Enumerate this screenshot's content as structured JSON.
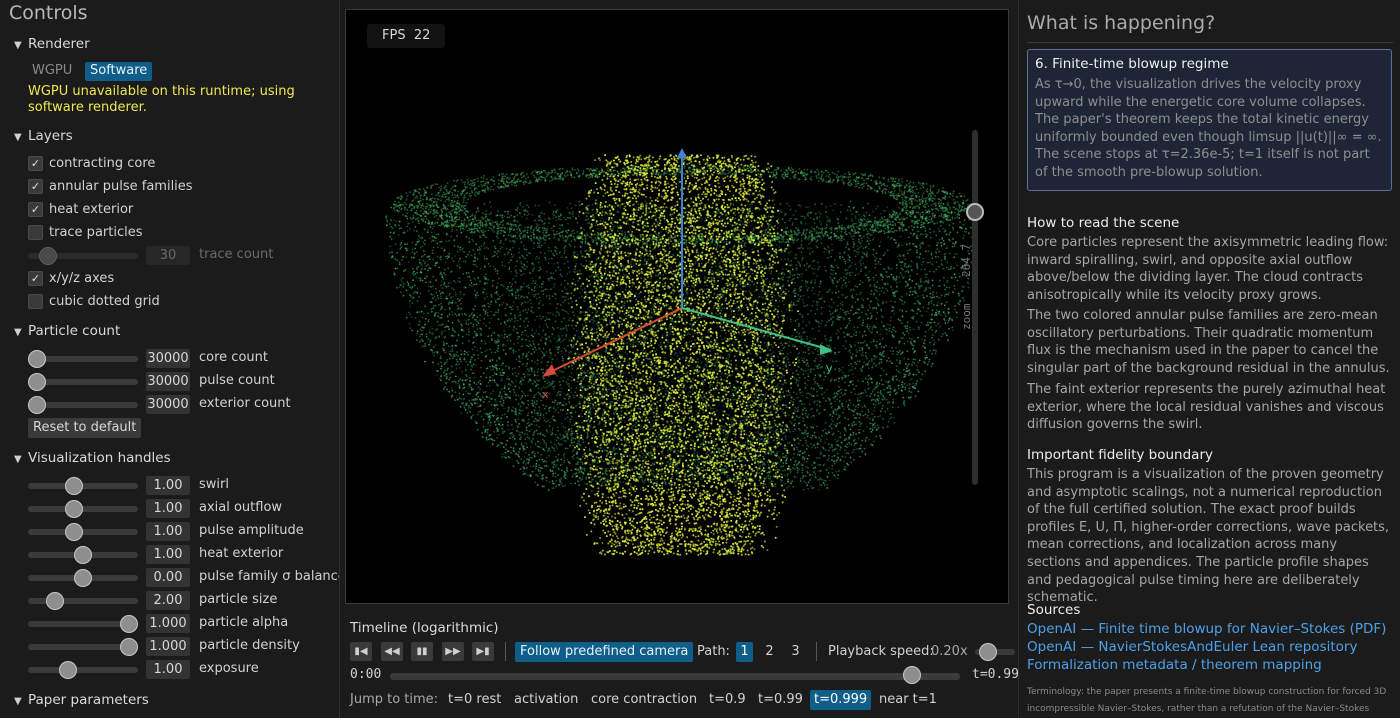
{
  "controls": {
    "title": "Controls",
    "renderer": {
      "heading": "Renderer",
      "modes": [
        "WGPU",
        "Software"
      ],
      "selected": "Software",
      "warning": "WGPU unavailable on this runtime; using software renderer."
    },
    "layers": {
      "heading": "Layers",
      "items": [
        {
          "label": "contracting core",
          "checked": true
        },
        {
          "label": "annular pulse families",
          "checked": true
        },
        {
          "label": "heat exterior",
          "checked": true
        },
        {
          "label": "trace particles",
          "checked": false
        },
        {
          "label": "x/y/z axes",
          "checked": true
        },
        {
          "label": "cubic dotted grid",
          "checked": false
        }
      ],
      "trace_count": {
        "label": "trace count",
        "value": "30",
        "level": 0.2,
        "disabled": true
      }
    },
    "particle_count": {
      "heading": "Particle count",
      "sliders": [
        {
          "label": "core count",
          "value": "30000",
          "level": 0.0
        },
        {
          "label": "pulse count",
          "value": "30000",
          "level": 0.0
        },
        {
          "label": "exterior count",
          "value": "30000",
          "level": 0.0
        }
      ],
      "reset_label": "Reset to default"
    },
    "visualization_handles": {
      "heading": "Visualization handles",
      "sliders": [
        {
          "label": "swirl",
          "value": "1.00",
          "level": 0.4
        },
        {
          "label": "axial outflow",
          "value": "1.00",
          "level": 0.4
        },
        {
          "label": "pulse amplitude",
          "value": "1.00",
          "level": 0.4
        },
        {
          "label": "heat exterior",
          "value": "1.00",
          "level": 0.5
        },
        {
          "label": "pulse family σ balance",
          "value": "0.00",
          "level": 0.5
        },
        {
          "label": "particle size",
          "value": "2.00",
          "level": 0.2
        },
        {
          "label": "particle alpha",
          "value": "1.000",
          "level": 1.0
        },
        {
          "label": "particle density",
          "value": "1.000",
          "level": 1.0
        },
        {
          "label": "exposure",
          "value": "1.00",
          "level": 0.34
        }
      ]
    },
    "paper_parameters": {
      "heading": "Paper parameters"
    }
  },
  "viewport": {
    "fps_label": "FPS",
    "fps_value": "22",
    "zoom_label": "zoom",
    "zoom_value": "264.7",
    "zoom_level": 0.78,
    "axes": {
      "x": "x",
      "y": "y",
      "x_color": "#d84a3a",
      "y_color": "#3ec088",
      "z_color": "#3a84d8"
    },
    "colors": {
      "core": "#e6f03a",
      "pulse": "#4ec86a",
      "exterior": "#2e9a68"
    }
  },
  "timeline": {
    "title": "Timeline (logarithmic)",
    "buttons": [
      "skip-start",
      "step-back",
      "pause",
      "step-forward",
      "skip-end"
    ],
    "follow_label": "Follow predefined camera",
    "path_label": "Path:",
    "paths": [
      "1",
      "2",
      "3"
    ],
    "path_selected": "1",
    "speed_label": "Playback speed:",
    "speed_value": "0.20x",
    "time_start": "0:00",
    "time_end": "t=0.99",
    "progress": 0.93,
    "jump_label": "Jump to time:",
    "jumps": [
      "t=0 rest",
      "activation",
      "core contraction",
      "t=0.9",
      "t=0.99",
      "t=0.999",
      "near t=1"
    ],
    "jump_selected": "t=0.999"
  },
  "info": {
    "title": "What is happening?",
    "card": {
      "title": "6. Finite-time blowup regime",
      "body": "As τ→0, the visualization drives the velocity proxy upward while the energetic core volume collapses. The paper's theorem keeps the total kinetic energy uniformly bounded even though limsup ||u(t)||∞ = ∞. The scene stops at τ=2.36e-5; t=1 itself is not part of the smooth pre-blowup solution."
    },
    "read_heading": "How to read the scene",
    "read_p1": "Core particles represent the axisymmetric leading flow: inward spiralling, swirl, and opposite axial outflow above/below the dividing layer. The cloud contracts anisotropically while its velocity proxy grows.",
    "read_p2": "The two colored annular pulse families are zero-mean oscillatory perturbations. Their quadratic momentum flux is the mechanism used in the paper to cancel the singular part of the background residual in the annulus.",
    "read_p3": "The faint exterior represents the purely azimuthal heat exterior, where the local residual vanishes and viscous diffusion governs the swirl.",
    "fidelity_heading": "Important fidelity boundary",
    "fidelity_p": "This program is a visualization of the proven geometry and asymptotic scalings, not a numerical reproduction of the full certified solution. The exact proof builds profiles E, U, Π, higher-order corrections, wave packets, mean corrections, and localization across many sections and appendices. The particle profile shapes and pedagogical pulse timing here are deliberately schematic.",
    "sources_heading": "Sources",
    "sources": [
      "OpenAI — Finite time blowup for Navier–Stokes (PDF)",
      "OpenAI — NavierStokesAndEuler Lean repository",
      "Formalization metadata / theorem mapping"
    ],
    "terminology": "Terminology: the paper presents a finite-time blowup construction for forced 3D incompressible Navier–Stokes, rather than a refutation of the Navier–Stokes"
  }
}
